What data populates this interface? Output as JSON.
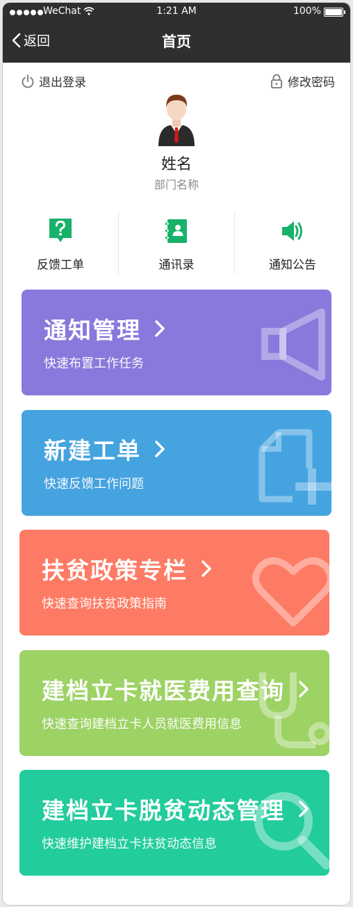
{
  "status": {
    "carrier": "WeChat",
    "time": "1:21 AM",
    "battery": "100%"
  },
  "nav": {
    "back_label": "返回",
    "title": "首页"
  },
  "header": {
    "logout_label": "退出登录",
    "change_password_label": "修改密码"
  },
  "profile": {
    "name": "姓名",
    "department": "部门名称"
  },
  "shortcuts": [
    {
      "label": "反馈工单",
      "icon": "question-bubble-icon"
    },
    {
      "label": "通讯录",
      "icon": "contacts-book-icon"
    },
    {
      "label": "通知公告",
      "icon": "speaker-icon"
    }
  ],
  "cards": [
    {
      "title": "通知管理",
      "subtitle": "快速布置工作任务",
      "color": "#8a78dc",
      "icon": "megaphone-icon"
    },
    {
      "title": "新建工单",
      "subtitle": "快速反馈工作问题",
      "color": "#45a3e0",
      "icon": "new-document-icon"
    },
    {
      "title": "扶贫政策专栏",
      "subtitle": "快速查询扶贫政策指南",
      "color": "#fd7b64",
      "icon": "heart-icon"
    },
    {
      "title": "建档立卡就医费用查询",
      "subtitle": "快速查询建档立卡人员就医费用信息",
      "color": "#9dd264",
      "icon": "stethoscope-icon"
    },
    {
      "title": "建档立卡脱贫动态管理",
      "subtitle": "快速维护建档立卡扶贫动态信息",
      "color": "#22cc9c",
      "icon": "magnifier-icon"
    }
  ],
  "colors": {
    "accent_green": "#18b26a",
    "nav_bg": "#2f2f31"
  }
}
